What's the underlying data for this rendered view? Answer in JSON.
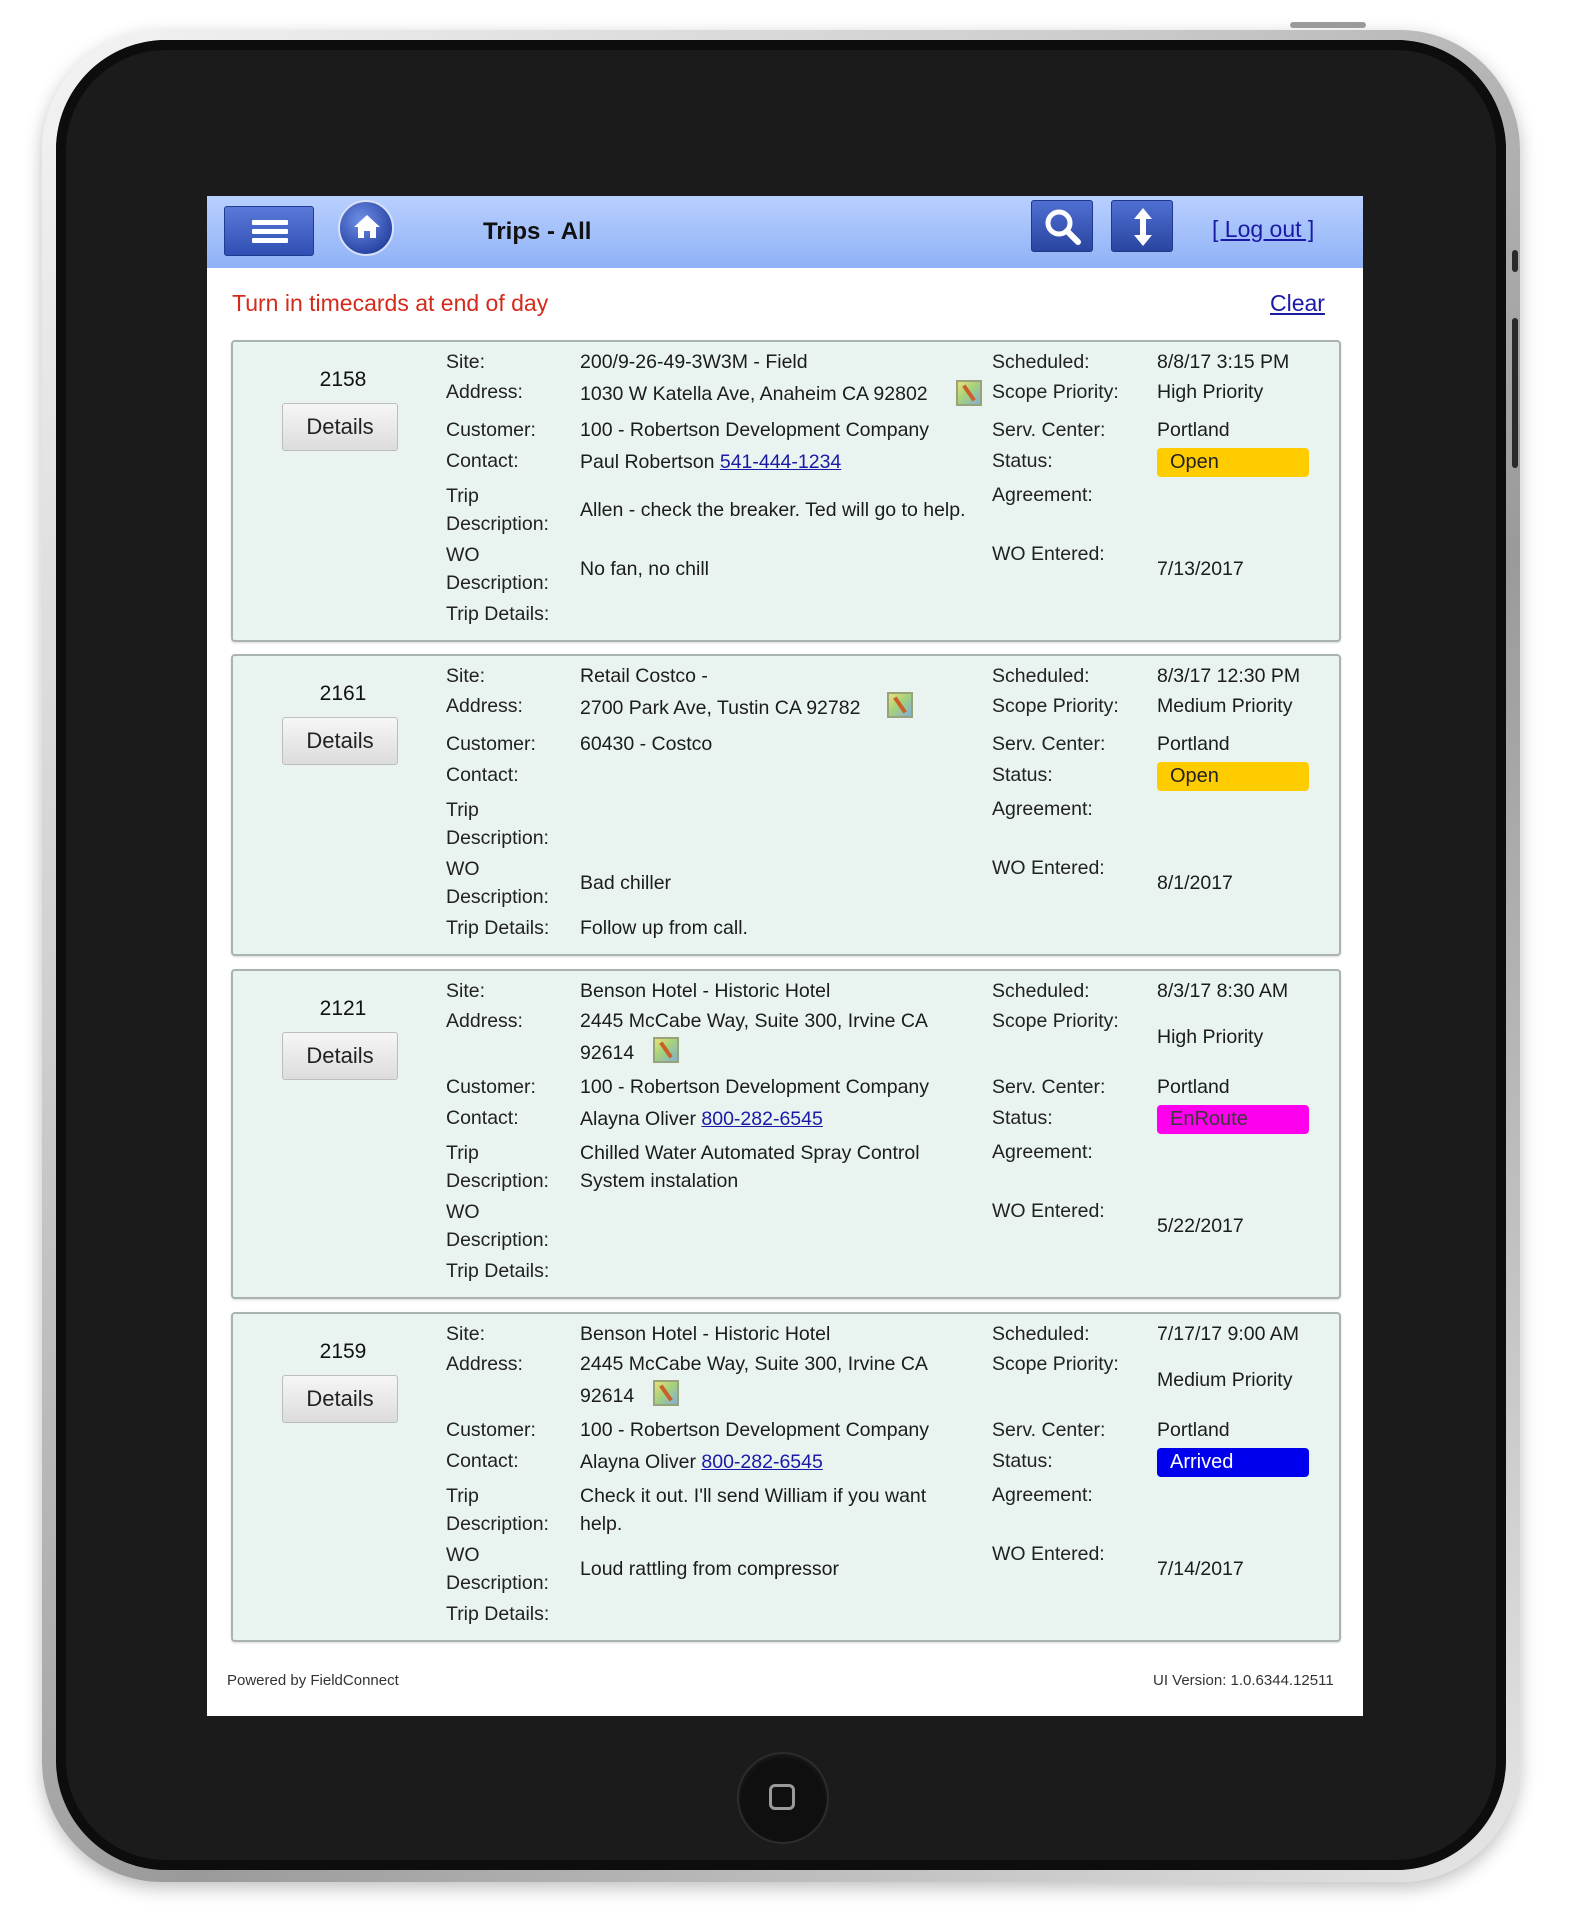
{
  "header": {
    "title": "Trips - All",
    "logout_label": "[ Log out ]"
  },
  "notice": "Turn in timecards at end of day",
  "clear_label": "Clear",
  "labels": {
    "site": "Site:",
    "address": "Address:",
    "customer": "Customer:",
    "contact": "Contact:",
    "trip_desc_1": "Trip",
    "trip_desc_2": "Description:",
    "wo_desc_1": "WO",
    "wo_desc_2": "Description:",
    "trip_details": "Trip Details:",
    "scheduled": "Scheduled:",
    "scope_priority": "Scope Priority:",
    "serv_center": "Serv. Center:",
    "status": "Status:",
    "agreement": "Agreement:",
    "wo_entered": "WO Entered:",
    "details_button": "Details"
  },
  "trips": [
    {
      "number": "2158",
      "site": "200/9-26-49-3W3M - Field",
      "address_line1": "1030 W Katella Ave, Anaheim CA 92802",
      "address_line2": "",
      "customer": "100 - Robertson Development Company",
      "contact_name": "Paul Robertson",
      "contact_phone": "541-444-1234",
      "trip_description": "Allen - check the breaker. Ted will go to help.",
      "wo_description": "No fan, no chill",
      "trip_details": "",
      "scheduled": "8/8/17 3:15 PM",
      "scope_priority": "High Priority",
      "serv_center": "Portland",
      "status": "Open",
      "status_color": "#ffcc00",
      "status_text_color": "#222222",
      "agreement": "",
      "wo_entered": "7/13/2017"
    },
    {
      "number": "2161",
      "site": "Retail Costco -",
      "address_line1": "2700 Park Ave, Tustin CA 92782",
      "address_line2": "",
      "customer": "60430 - Costco",
      "contact_name": "",
      "contact_phone": "",
      "trip_description": "",
      "wo_description": "Bad chiller",
      "trip_details": "Follow up from call.",
      "scheduled": "8/3/17 12:30 PM",
      "scope_priority": "Medium Priority",
      "serv_center": "Portland",
      "status": "Open",
      "status_color": "#ffcc00",
      "status_text_color": "#222222",
      "agreement": "",
      "wo_entered": "8/1/2017"
    },
    {
      "number": "2121",
      "site": "Benson Hotel - Historic Hotel",
      "address_line1": "2445 McCabe Way, Suite 300, Irvine CA",
      "address_line2": "92614",
      "customer": "100 - Robertson Development Company",
      "contact_name": "Alayna Oliver",
      "contact_phone": "800-282-6545",
      "trip_description": "Chilled Water Automated Spray Control System instalation",
      "wo_description": "",
      "trip_details": "",
      "scheduled": "8/3/17 8:30 AM",
      "scope_priority": "High Priority",
      "serv_center": "Portland",
      "status": "EnRoute",
      "status_color": "#ff00ee",
      "status_text_color": "#3a3a3a",
      "agreement": "",
      "wo_entered": "5/22/2017"
    },
    {
      "number": "2159",
      "site": "Benson Hotel - Historic Hotel",
      "address_line1": "2445 McCabe Way, Suite 300, Irvine CA",
      "address_line2": "92614",
      "customer": "100 - Robertson Development Company",
      "contact_name": "Alayna Oliver",
      "contact_phone": "800-282-6545",
      "trip_description": "Check it out. I'll send William if you want help.",
      "wo_description": "Loud rattling from compressor",
      "trip_details": "",
      "scheduled": "7/17/17 9:00 AM",
      "scope_priority": "Medium Priority",
      "serv_center": "Portland",
      "status": "Arrived",
      "status_color": "#0000ee",
      "status_text_color": "#ffffff",
      "agreement": "",
      "wo_entered": "7/14/2017"
    }
  ],
  "footer": {
    "powered_by": "Powered by FieldConnect",
    "ui_version": "UI Version: 1.0.6344.12511"
  }
}
